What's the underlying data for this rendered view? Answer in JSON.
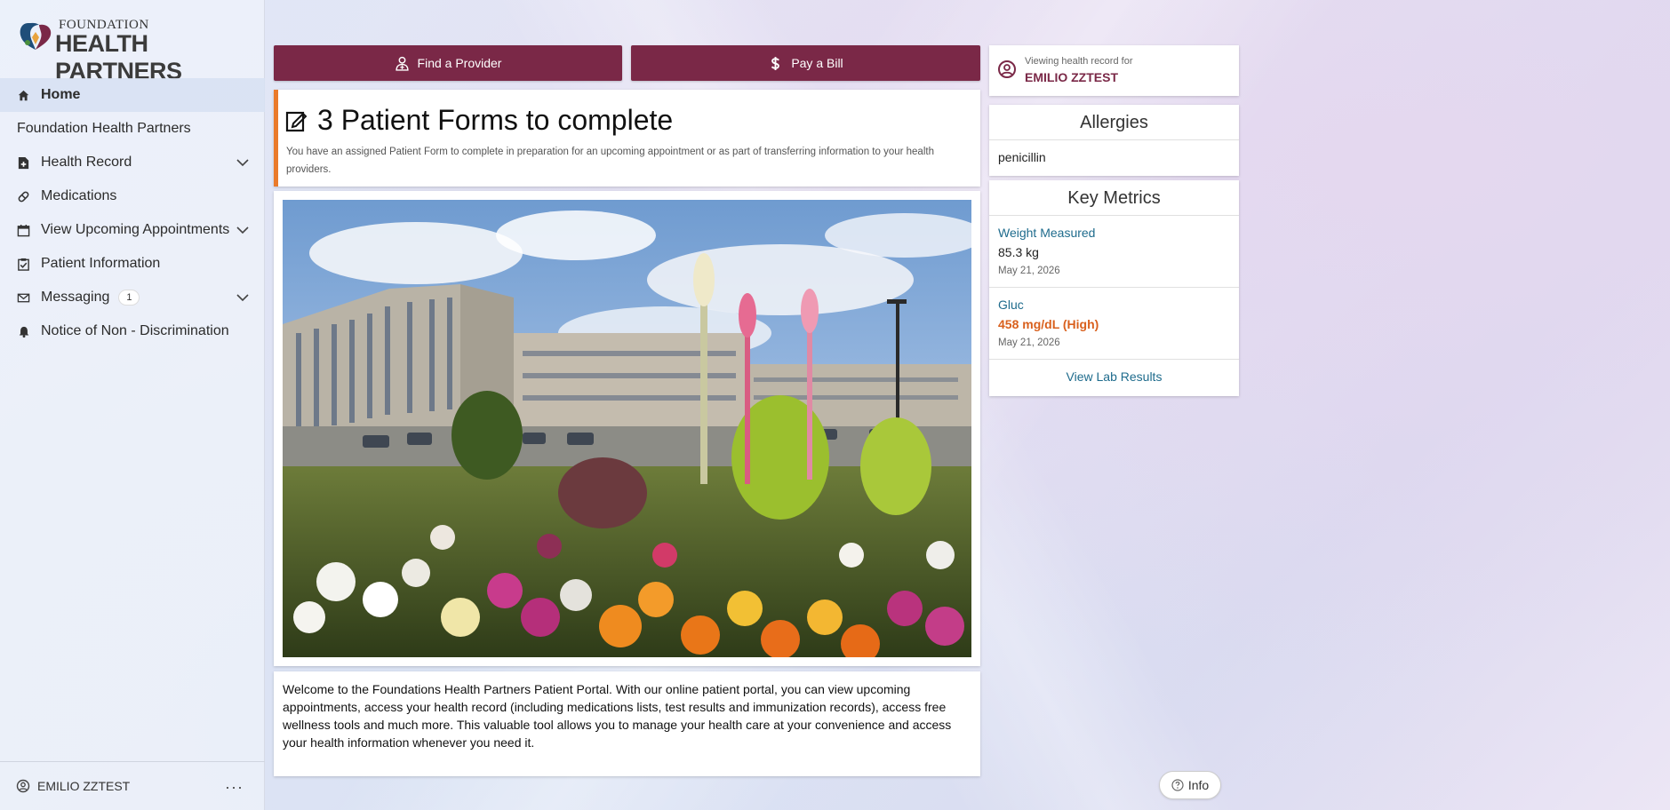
{
  "brand": {
    "top": "FOUNDATION",
    "main": "HEALTH PARTNERS"
  },
  "nav": {
    "items": [
      {
        "label": "Home",
        "icon": "home-icon"
      },
      {
        "label": "Foundation Health Partners"
      },
      {
        "label": "Health Record",
        "icon": "file-plus-icon"
      },
      {
        "label": "Medications",
        "icon": "pill-icon"
      },
      {
        "label": "View Upcoming Appointments",
        "icon": "calendar-icon"
      },
      {
        "label": "Patient Information",
        "icon": "clipboard-check-icon"
      },
      {
        "label": "Messaging",
        "icon": "envelope-icon",
        "badge": "1"
      },
      {
        "label": "Notice of Non - Discrimination",
        "icon": "bell-icon"
      }
    ]
  },
  "footer": {
    "user": "EMILIO ZZTEST",
    "more": "···"
  },
  "actions": {
    "find_provider": "Find a Provider",
    "pay_bill": "Pay a Bill"
  },
  "forms": {
    "title": "3 Patient Forms to complete",
    "description": "You have an assigned Patient Form to complete in preparation for an upcoming appointment or as part of transferring information to your health providers."
  },
  "welcome": "Welcome to the Foundations Health Partners Patient Portal. With our online patient portal, you can view upcoming appointments, access your health record (including medications lists, test results and immunization records), access free wellness tools and much more. This valuable tool allows you to manage your health care at your convenience and access your health information whenever you need it.",
  "viewing": {
    "label": "Viewing health record for",
    "name": "EMILIO ZZTEST"
  },
  "allergies": {
    "title": "Allergies",
    "items": [
      "penicillin"
    ]
  },
  "metrics": {
    "title": "Key Metrics",
    "items": [
      {
        "name": "Weight Measured",
        "value": "85.3 kg",
        "date": "May 21, 2026"
      },
      {
        "name": "Gluc",
        "value": "458 mg/dL (High)",
        "date": "May 21, 2026"
      }
    ],
    "link": "View Lab Results"
  },
  "info_button": "Info",
  "colors": {
    "primary": "#7a2847",
    "accent_orange": "#ea7a2a",
    "link": "#1e6b8c",
    "high": "#d9601d"
  }
}
